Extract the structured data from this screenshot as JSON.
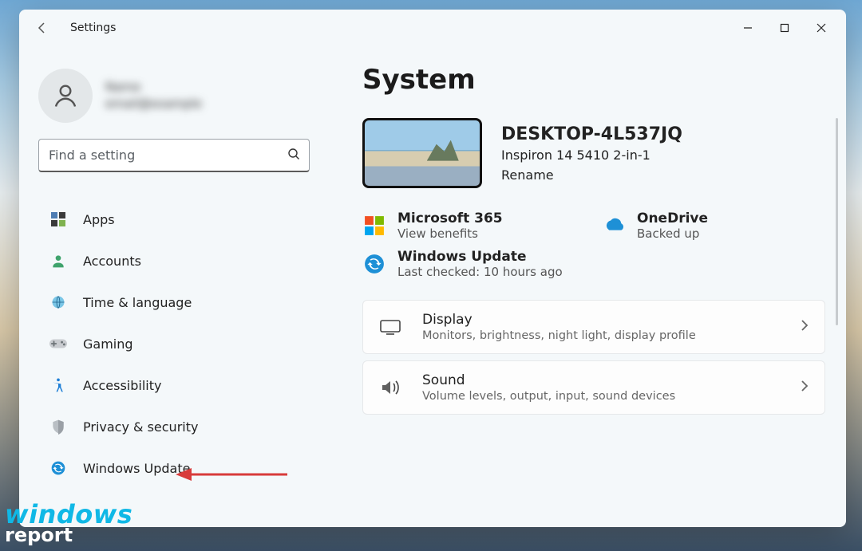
{
  "titlebar": {
    "title": "Settings"
  },
  "user": {
    "line1": "Name",
    "line2": "email@example"
  },
  "search": {
    "placeholder": "Find a setting"
  },
  "sidebar": {
    "items": [
      {
        "label": "Apps"
      },
      {
        "label": "Accounts"
      },
      {
        "label": "Time & language"
      },
      {
        "label": "Gaming"
      },
      {
        "label": "Accessibility"
      },
      {
        "label": "Privacy & security"
      },
      {
        "label": "Windows Update"
      }
    ]
  },
  "page": {
    "title": "System"
  },
  "device": {
    "name": "DESKTOP-4L537JQ",
    "model": "Inspiron 14 5410 2-in-1",
    "rename": "Rename"
  },
  "status": {
    "ms365": {
      "title": "Microsoft 365",
      "sub": "View benefits"
    },
    "onedrive": {
      "title": "OneDrive",
      "sub": "Backed up"
    },
    "update": {
      "title": "Windows Update",
      "sub": "Last checked: 10 hours ago"
    }
  },
  "cards": {
    "display": {
      "title": "Display",
      "sub": "Monitors, brightness, night light, display profile"
    },
    "sound": {
      "title": "Sound",
      "sub": "Volume levels, output, input, sound devices"
    }
  },
  "watermark": {
    "top": "windows",
    "bot": "report"
  }
}
